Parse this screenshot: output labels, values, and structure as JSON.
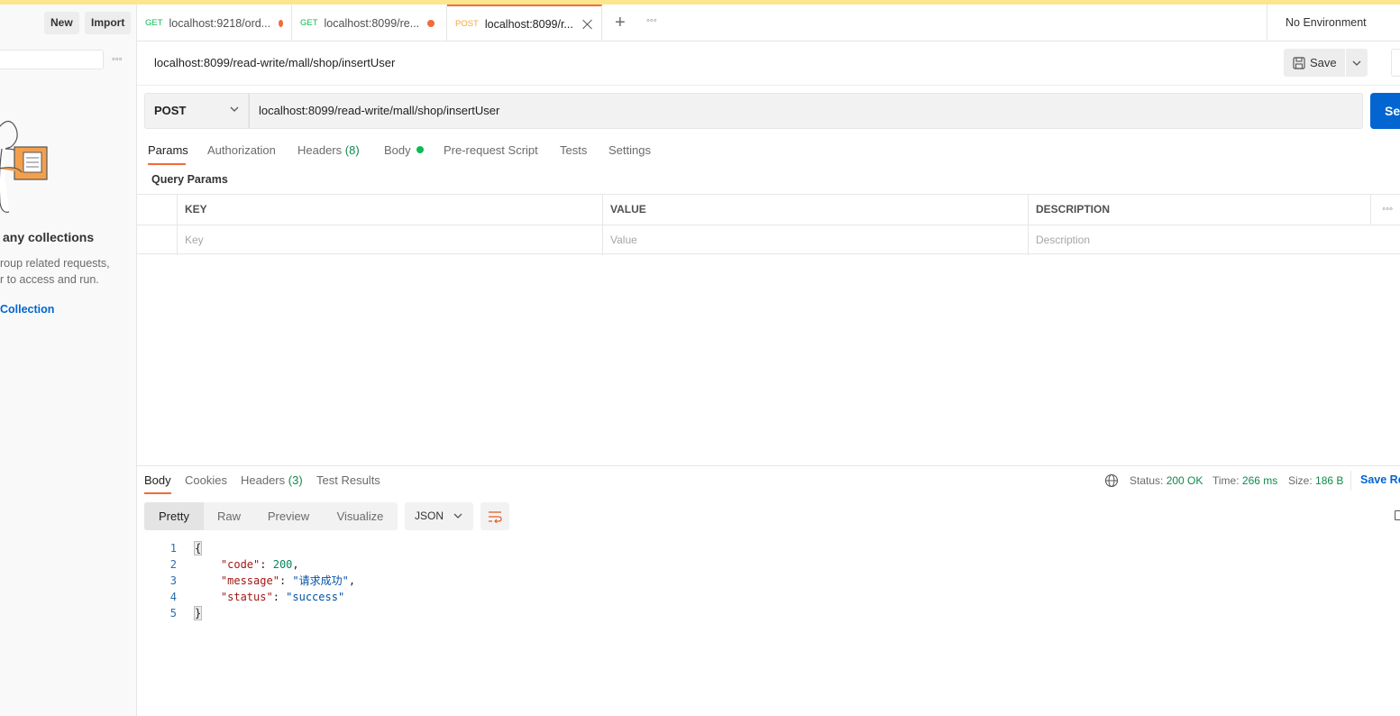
{
  "sidebar": {
    "new_label": "New",
    "import_label": "Import",
    "empty_heading": "any collections",
    "empty_desc_line1": "roup related requests,",
    "empty_desc_line2": "r to access and run.",
    "create_link": "Collection"
  },
  "tabs": [
    {
      "method": "GET",
      "title": "localhost:9218/ord...",
      "method_color": "#0cbb52"
    },
    {
      "method": "GET",
      "title": "localhost:8099/re...",
      "method_color": "#0cbb52"
    },
    {
      "method": "POST",
      "title": "localhost:8099/r...",
      "method_color": "#f2a93a"
    }
  ],
  "environment": "No Environment",
  "request": {
    "name": "localhost:8099/read-write/mall/shop/insertUser",
    "save_label": "Save",
    "method": "POST",
    "url": "localhost:8099/read-write/mall/shop/insertUser",
    "send_label": "Se"
  },
  "request_tabs": {
    "params": "Params",
    "authorization": "Authorization",
    "headers": "Headers",
    "headers_count": "(8)",
    "body": "Body",
    "pre_request": "Pre-request Script",
    "tests": "Tests",
    "settings": "Settings"
  },
  "query_params": {
    "title": "Query Params",
    "columns": [
      "KEY",
      "VALUE",
      "DESCRIPTION"
    ],
    "placeholders": [
      "Key",
      "Value",
      "Description"
    ]
  },
  "response": {
    "tabs": {
      "body": "Body",
      "cookies": "Cookies",
      "headers": "Headers",
      "headers_count": "(3)",
      "test_results": "Test Results"
    },
    "status_label": "Status:",
    "status_value": "200 OK",
    "time_label": "Time:",
    "time_value": "266 ms",
    "size_label": "Size:",
    "size_value": "186 B",
    "save_response": "Save Re",
    "views": [
      "Pretty",
      "Raw",
      "Preview",
      "Visualize"
    ],
    "format": "JSON",
    "code_lines": [
      "1",
      "2",
      "3",
      "4",
      "5"
    ],
    "json": {
      "code_key": "\"code\"",
      "code_val": "200",
      "message_key": "\"message\"",
      "message_val": "\"请求成功\"",
      "status_key": "\"status\"",
      "status_val": "\"success\""
    }
  },
  "colors": {
    "accent": "#f26b3a",
    "primary": "#0265d2",
    "success": "#0cbb52"
  }
}
